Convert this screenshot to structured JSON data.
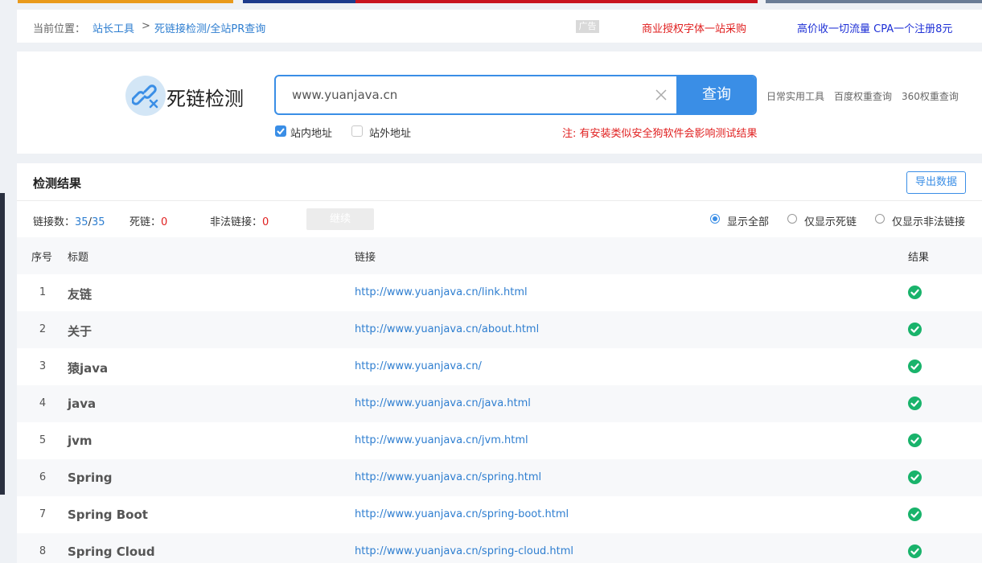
{
  "breadcrumb": {
    "label": "当前位置：",
    "items": [
      "站长工具",
      "死链接检测/全站PR查询"
    ],
    "separator": ">"
  },
  "ads": {
    "tag": "广告",
    "links": [
      "商业授权字体一站采购",
      "高价收一切流量 CPA一个注册8元"
    ]
  },
  "search": {
    "logo_text": "死链检测",
    "value": "www.yuanjava.cn",
    "button_label": "查询",
    "options": [
      {
        "label": "站内地址",
        "checked": true
      },
      {
        "label": "站外地址",
        "checked": false
      }
    ],
    "notice": "注: 有安装类似安全狗软件会影响测试结果",
    "tools": [
      "日常实用工具",
      "百度权重查询",
      "360权重查询"
    ]
  },
  "results": {
    "title": "检测结果",
    "export_label": "导出数据",
    "stats": {
      "links_label": "链接数：",
      "links_done": "35",
      "links_slash": "/",
      "links_total": "35",
      "dead_label": "死链：",
      "dead_count": "0",
      "illegal_label": "非法链接：",
      "illegal_count": "0"
    },
    "continue_label": "继续",
    "filters": [
      {
        "label": "显示全部",
        "selected": true
      },
      {
        "label": "仅显示死链",
        "selected": false
      },
      {
        "label": "仅显示非法链接",
        "selected": false
      }
    ],
    "columns": [
      "序号",
      "标题",
      "链接",
      "结果"
    ],
    "rows": [
      {
        "no": "1",
        "title": "友链",
        "url": "http://www.yuanjava.cn/link.html",
        "status": "ok"
      },
      {
        "no": "2",
        "title": "关于",
        "url": "http://www.yuanjava.cn/about.html",
        "status": "ok"
      },
      {
        "no": "3",
        "title": "猿java",
        "url": "http://www.yuanjava.cn/",
        "status": "ok"
      },
      {
        "no": "4",
        "title": "java",
        "url": "http://www.yuanjava.cn/java.html",
        "status": "ok"
      },
      {
        "no": "5",
        "title": "jvm",
        "url": "http://www.yuanjava.cn/jvm.html",
        "status": "ok"
      },
      {
        "no": "6",
        "title": "Spring",
        "url": "http://www.yuanjava.cn/spring.html",
        "status": "ok"
      },
      {
        "no": "7",
        "title": "Spring Boot",
        "url": "http://www.yuanjava.cn/spring-boot.html",
        "status": "ok"
      },
      {
        "no": "8",
        "title": "Spring Cloud",
        "url": "http://www.yuanjava.cn/spring-cloud.html",
        "status": "ok"
      }
    ]
  },
  "colors": {
    "accent": "#3a8ee6",
    "link": "#2e7ed0",
    "warning": "#e02020",
    "success": "#19b36b"
  },
  "icons": {
    "logo": "broken-link-icon",
    "clear": "close-icon",
    "result_ok": "check-circle-icon"
  }
}
